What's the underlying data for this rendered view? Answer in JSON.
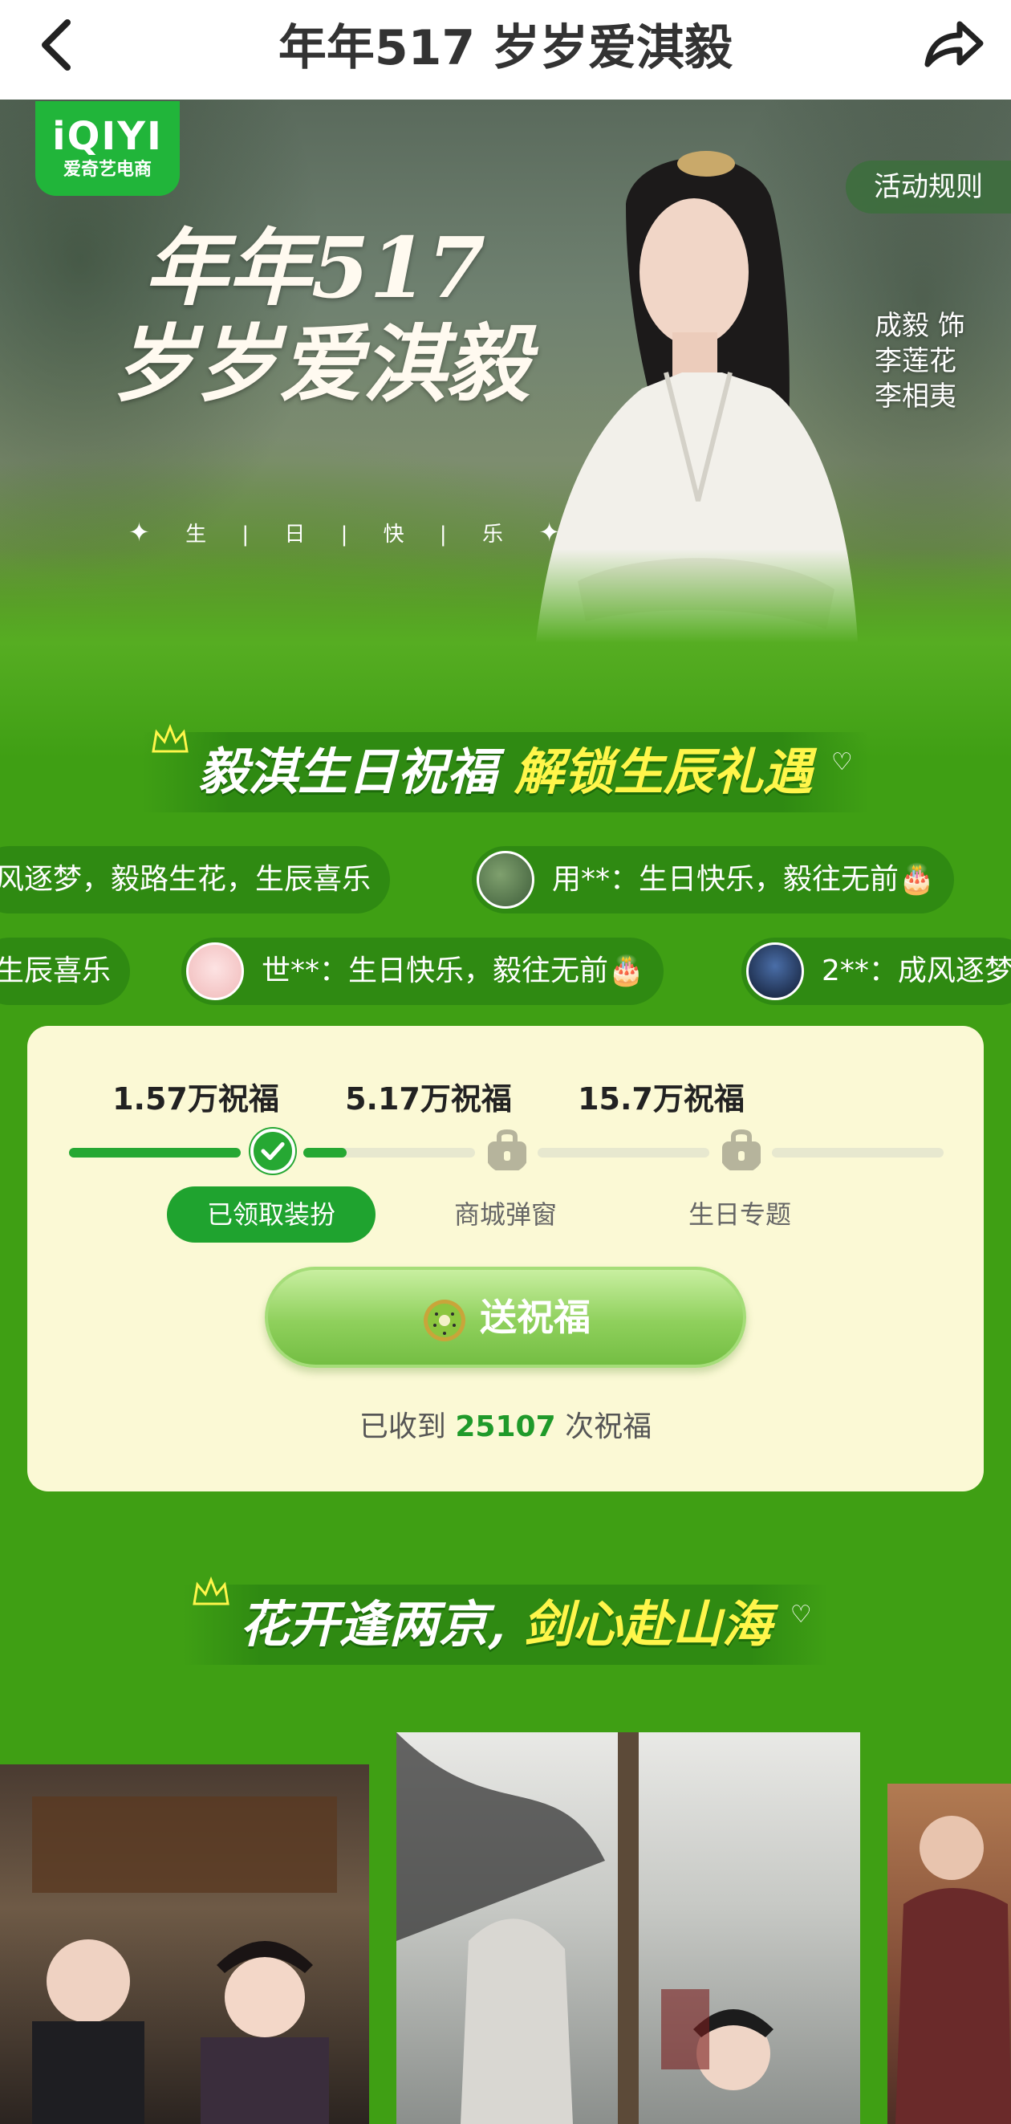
{
  "header": {
    "title": "年年517 岁岁爱淇毅"
  },
  "banner": {
    "logo_main": "iQIYI",
    "logo_sub": "爱奇艺电商",
    "rules_button": "活动规则",
    "title_line1": "年年517",
    "title_line2": "岁岁爱淇毅",
    "subtitle": "生 | 日 | 快 | 乐",
    "credit": "成毅 饰 李莲花 李相夷"
  },
  "section1": {
    "title_part1": "毅淇生日祝福",
    "title_part2": "解锁生辰礼遇"
  },
  "wishes": {
    "row1": [
      {
        "text": "风逐梦，毅路生花，生辰喜乐",
        "avatar": false
      },
      {
        "text": "用**：生日快乐，毅往无前🎂",
        "avatar": true,
        "avatar_color": "#4f7a4a"
      }
    ],
    "row2": [
      {
        "text": "生辰喜乐",
        "avatar": false
      },
      {
        "text": "世**：生日快乐，毅往无前🎂",
        "avatar": true,
        "avatar_color": "#f4c6c6"
      },
      {
        "text": "2**：成风逐梦",
        "avatar": true,
        "avatar_color": "#203050"
      }
    ]
  },
  "milestones": {
    "labels": [
      "1.57万祝福",
      "5.17万祝福",
      "15.7万祝福"
    ],
    "rewards": [
      "已领取装扮",
      "商城弹窗",
      "生日专题"
    ],
    "progress_segments": [
      1.0,
      0.25,
      0.0,
      0.0
    ],
    "send_button": "送祝福",
    "received_prefix": "已收到",
    "received_count": "25107",
    "received_suffix": "次祝福"
  },
  "section2": {
    "title_part1": "花开逢两京,",
    "title_part2": "剑心赴山海"
  },
  "colors": {
    "brand_green": "#21b53a",
    "page_green": "#3f9f14",
    "card_bg": "#fbf9d5",
    "highlight_yellow": "#fff64a"
  }
}
